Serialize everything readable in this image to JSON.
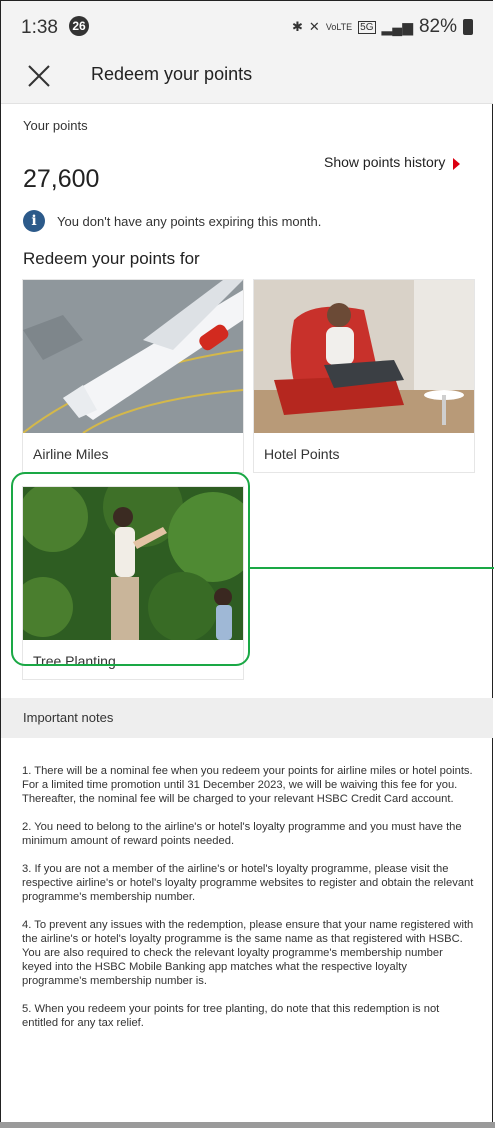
{
  "status_bar": {
    "time": "1:38",
    "notification_count": "26",
    "icons": [
      "bluetooth-icon",
      "mute-icon",
      "volte-icon",
      "5g-icon",
      "signal-icon",
      "battery-icon"
    ],
    "battery": "82%"
  },
  "app_bar": {
    "close_icon": "close-icon",
    "title": "Redeem your points"
  },
  "points": {
    "label": "Your points",
    "value": "27,600",
    "history_link": "Show points history",
    "info_text": "You don't have any points expiring this month."
  },
  "redeem": {
    "title": "Redeem your points for",
    "options": [
      {
        "label": "Airline Miles",
        "image": "airplane-photo"
      },
      {
        "label": "Hotel Points",
        "image": "woman-red-chair-photo"
      },
      {
        "label": "Tree Planting",
        "image": "mother-child-trees-photo"
      }
    ]
  },
  "notes": {
    "title": "Important notes",
    "items": [
      "1. There will be a nominal fee when you redeem your points for airline miles or hotel points. For a limited time promotion until 31 December 2023, we will be waiving this fee for you. Thereafter, the nominal fee will be charged to your relevant HSBC Credit Card account.",
      "2. You need to belong to the airline's or hotel's loyalty programme and you must have the minimum amount of reward points needed.",
      "3. If you are not a member of the airline's or hotel's loyalty programme, please visit the respective airline's or hotel's loyalty programme websites to register and obtain the relevant programme's membership number.",
      "4. To prevent any issues with the redemption, please ensure that your name registered with the airline's or hotel's loyalty programme is the same name as that registered with HSBC. You are also required to check the relevant loyalty programme's membership number keyed into the HSBC Mobile Banking app matches what the respective loyalty programme's membership number is.",
      "5. When you redeem your points for tree planting, do note that this redemption is not entitled for any tax relief."
    ]
  },
  "colors": {
    "accent_red": "#db0011",
    "info_blue": "#2c5a8a",
    "highlight_green": "#1aa845"
  }
}
